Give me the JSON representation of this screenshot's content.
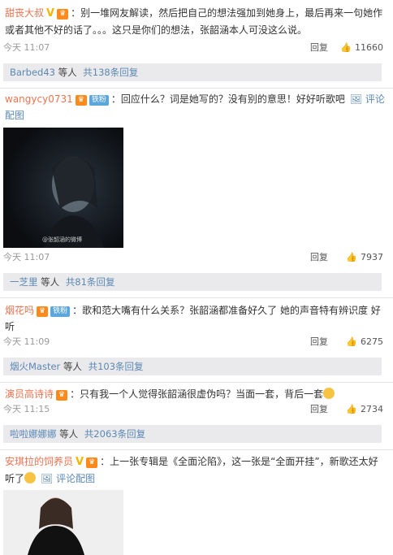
{
  "comments": [
    {
      "user": "甜丧大叔",
      "badge": "V",
      "text": "别一堆网友解读，然后把自己的想法强加到她身上，最后再来一句她作或者其他不好的话了。。。这只是你们的想法，张韶涵本人可没这么说。",
      "time": "今天 11:07",
      "reply": "回复",
      "likes": "11660",
      "replies": {
        "user": "Barbed43",
        "mid": "等人",
        "count": "共138条回复"
      }
    },
    {
      "user": "wangycy0731",
      "fan_tag": "铁粉",
      "text": "回应什么？词是她写的？没有别的意思！好好听歌吧",
      "image_link": "评论配图",
      "time": "今天 11:07",
      "reply": "回复",
      "likes": "7937",
      "image_caption": "@张韶涵的微博",
      "replies": {
        "user": "一芝里",
        "mid": "等人",
        "count": "共81条回复"
      }
    },
    {
      "user": "烟花吗",
      "fan_tag": "铁粉",
      "text": "歌和范大嘴有什么关系？张韶涵都准备好久了 她的声音特有辨识度 好听",
      "time": "今天 11:09",
      "reply": "回复",
      "likes": "6275",
      "replies": {
        "user": "烟火Master",
        "mid": "等人",
        "count": "共103条回复"
      }
    },
    {
      "user": "演员高诗诗",
      "text": "只有我一个人觉得张韶涵很虚伪吗？当面一套，背后一套",
      "time": "今天 11:15",
      "reply": "回复",
      "likes": "2734",
      "replies": {
        "user": "啦啦娜娜娜",
        "mid": "等人",
        "count": "共2063条回复"
      }
    },
    {
      "user": "安琪拉的饲养员",
      "badge": "V",
      "text": "上一张专辑是《全面沦陷》，这一张是“全面开挂”，新歌还太好听了",
      "image_link": "评论配图"
    }
  ],
  "icons": {
    "level": "crown-level-icon",
    "image": "picture-icon",
    "like": "thumbs-up-icon"
  },
  "colors": {
    "username": "#eb7350",
    "link": "#5b88b5",
    "vip": "#f7b500",
    "replybar": "#eaeaec"
  }
}
